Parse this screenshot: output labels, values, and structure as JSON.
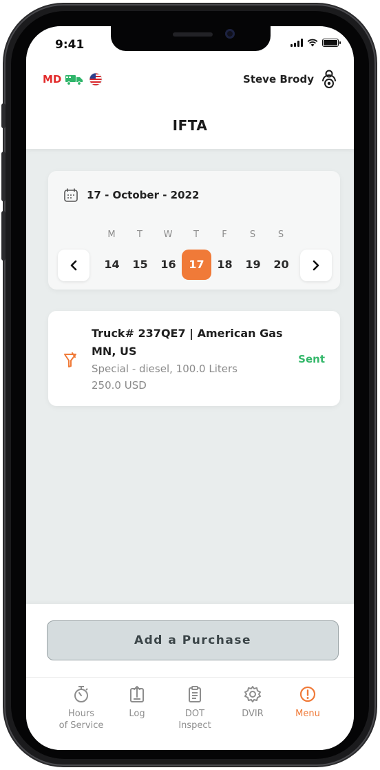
{
  "status_bar": {
    "time": "9:41"
  },
  "header": {
    "driver_code": "MD",
    "user_name": "Steve Brody",
    "title": "IFTA"
  },
  "calendar": {
    "date_label": "17 - October - 2022",
    "weekdays": [
      "M",
      "T",
      "W",
      "T",
      "F",
      "S",
      "S"
    ],
    "days": [
      "14",
      "15",
      "16",
      "17",
      "18",
      "19",
      "20"
    ],
    "selected_day": "17",
    "prev": "‹",
    "next": "›"
  },
  "purchase": {
    "line1": "Truck# 237QE7 | American Gas",
    "line2": "MN, US",
    "line3": "Special - diesel, 100.0 Liters",
    "line4": "250.0 USD",
    "status": "Sent"
  },
  "add_button_label": "Add a Purchase",
  "tabs": [
    {
      "label": "Hours\nof Service",
      "icon": "stopwatch-icon",
      "active": false
    },
    {
      "label": "Log",
      "icon": "log-upload-icon",
      "active": false
    },
    {
      "label": "DOT\nInspect",
      "icon": "clipboard-icon",
      "active": false
    },
    {
      "label": "DVIR",
      "icon": "gear-icon",
      "active": false
    },
    {
      "label": "Menu",
      "icon": "info-circle-icon",
      "active": true
    }
  ],
  "colors": {
    "accent": "#f07a38",
    "sent": "#35b86b",
    "md_red": "#e22b2b",
    "truck_green": "#2fb56a"
  }
}
